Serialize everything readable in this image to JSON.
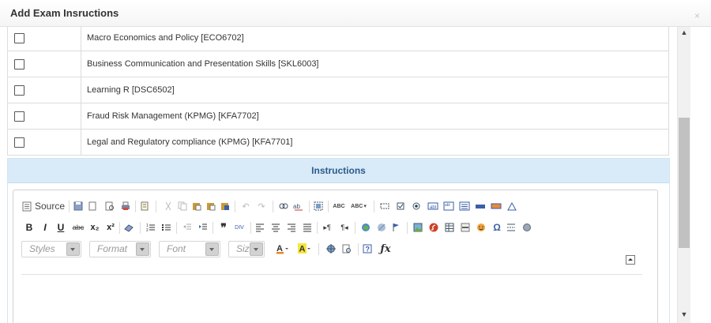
{
  "dialog": {
    "title": "Add Exam Insructions",
    "close_icon": "×"
  },
  "courses": [
    {
      "name": "Macro Economics and Policy [ECO6702]",
      "checked": false
    },
    {
      "name": "Business Communication and Presentation Skills [SKL6003]",
      "checked": false
    },
    {
      "name": "Learning R [DSC6502]",
      "checked": false
    },
    {
      "name": "Fraud Risk Management (KPMG) [KFA7702]",
      "checked": false
    },
    {
      "name": "Legal and Regulatory compliance (KPMG) [KFA7701]",
      "checked": false
    }
  ],
  "instructions": {
    "heading": "Instructions"
  },
  "editor": {
    "source_label": "Source",
    "styles_placeholder": "Styles",
    "format_placeholder": "Format",
    "font_placeholder": "Font",
    "size_placeholder": "Size",
    "bold": "B",
    "italic": "I",
    "underline": "U",
    "strike": "abc",
    "subscript": "x₂",
    "superscript": "x²",
    "formula": "ƒx",
    "spellcheck": "ABC",
    "toolbar_row1_icons": [
      "save-icon",
      "new-page-icon",
      "preview-icon",
      "print-icon",
      "templates-icon",
      "cut-icon",
      "copy-icon",
      "paste-icon",
      "paste-text-icon",
      "paste-word-icon",
      "undo-icon",
      "redo-icon",
      "find-icon",
      "replace-icon",
      "select-all-icon",
      "spellcheck-icon",
      "spellcheck-as-you-type-icon",
      "form-icon",
      "checkbox-icon",
      "radio-icon",
      "text-field-icon",
      "textarea-icon",
      "select-icon",
      "button-icon",
      "image-button-icon",
      "hidden-field-icon"
    ],
    "toolbar_row2_icons": [
      "bold-icon",
      "italic-icon",
      "underline-icon",
      "strikethrough-icon",
      "subscript-icon",
      "superscript-icon",
      "remove-format-icon",
      "numbered-list-icon",
      "bulleted-list-icon",
      "outdent-icon",
      "indent-icon",
      "blockquote-icon",
      "div-container-icon",
      "align-left-icon",
      "align-center-icon",
      "align-right-icon",
      "justify-icon",
      "ltr-icon",
      "rtl-icon",
      "link-icon",
      "unlink-icon",
      "anchor-icon",
      "image-icon",
      "flash-icon",
      "table-icon",
      "horizontal-line-icon",
      "smiley-icon",
      "special-char-icon",
      "page-break-icon",
      "iframe-icon"
    ],
    "toolbar_row3_icons": [
      "text-color-icon",
      "background-color-icon",
      "maximize-icon",
      "show-blocks-icon",
      "about-icon",
      "formula-icon"
    ]
  }
}
